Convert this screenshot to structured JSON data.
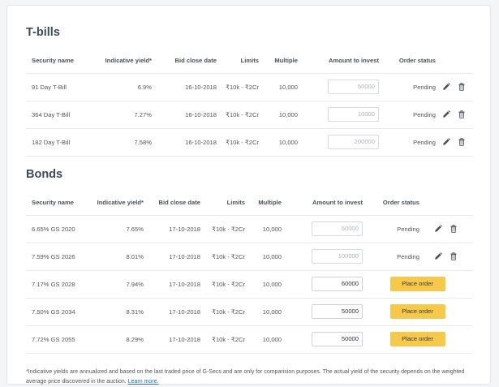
{
  "tbills": {
    "title": "T-bills",
    "headers": [
      "Security name",
      "Indicative yield*",
      "Bid close date",
      "Limits",
      "Multiple",
      "Amount to invest",
      "Order status"
    ],
    "rows": [
      {
        "name": "91 Day T-Bill",
        "yield": "6.9%",
        "date": "16-10-2018",
        "limits": "₹10k - ₹2Cr",
        "multiple": "10,000",
        "amount": "50000",
        "status": "Pending"
      },
      {
        "name": "364 Day T-Bill",
        "yield": "7.27%",
        "date": "16-10-2018",
        "limits": "₹10k - ₹2Cr",
        "multiple": "10,000",
        "amount": "10000",
        "status": "Pending"
      },
      {
        "name": "182 Day T-Bill",
        "yield": "7.58%",
        "date": "16-10-2018",
        "limits": "₹10k - ₹2Cr",
        "multiple": "10,000",
        "amount": "200000",
        "status": "Pending"
      }
    ]
  },
  "bonds": {
    "title": "Bonds",
    "headers": [
      "Security name",
      "Indicative yield*",
      "Bid close date",
      "Limits",
      "Multiple",
      "Amount to invest",
      "Order status"
    ],
    "rows": [
      {
        "name": "6.65% GS 2020",
        "yield": "7.65%",
        "date": "17-10-2018",
        "limits": "₹10k - ₹2Cr",
        "multiple": "10,000",
        "amount": "50000",
        "status": "Pending"
      },
      {
        "name": "7.59% GS 2026",
        "yield": "8.01%",
        "date": "17-10-2018",
        "limits": "₹10k - ₹2Cr",
        "multiple": "10,000",
        "amount": "100000",
        "status": "Pending"
      },
      {
        "name": "7.17% GS 2028",
        "yield": "7.94%",
        "date": "17-10-2018",
        "limits": "₹10k - ₹2Cr",
        "multiple": "10,000",
        "amount": "60000",
        "action": "Place order"
      },
      {
        "name": "7.50% GS 2034",
        "yield": "8.31%",
        "date": "17-10-2018",
        "limits": "₹10k - ₹2Cr",
        "multiple": "10,000",
        "amount": "50000",
        "action": "Place order"
      },
      {
        "name": "7.72% GS 2055",
        "yield": "8.29%",
        "date": "17-10-2018",
        "limits": "₹10k - ₹2Cr",
        "multiple": "10,000",
        "amount": "50000",
        "action": "Place order"
      }
    ]
  },
  "footnote": {
    "text": "*Indicative yields are annualized and based on the last traded price of G-Secs and are only for comparision purposes. The actual yield of the security depends on the weighted average price discovered in the auction.",
    "link": "Learn more."
  },
  "colors": {
    "button": "#f7c94b",
    "heading": "#3d4a5c",
    "link": "#2b6cb0"
  },
  "icons": {
    "edit": "pencil-icon",
    "delete": "trash-icon"
  }
}
